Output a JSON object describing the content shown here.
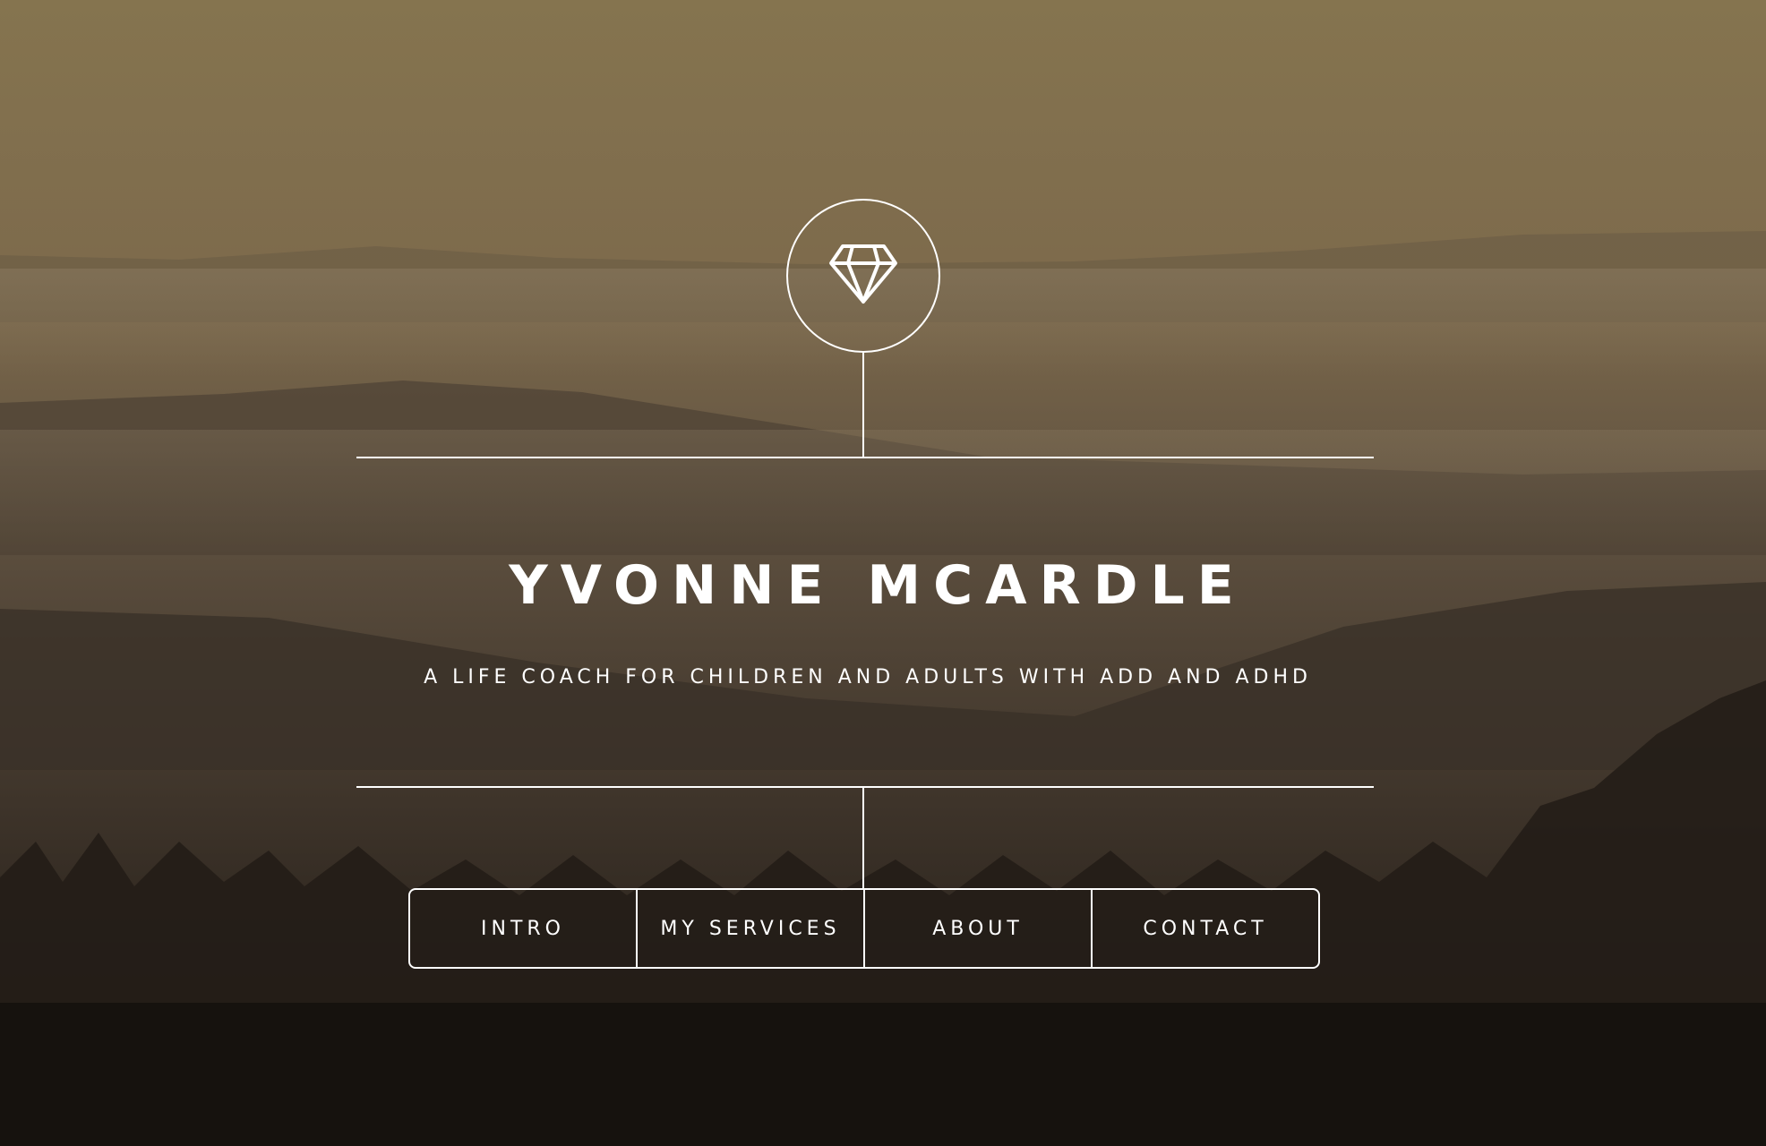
{
  "hero": {
    "logo_icon": "diamond-icon",
    "title": "YVONNE MCARDLE",
    "subtitle": "A LIFE COACH FOR CHILDREN AND ADULTS WITH ADD AND ADHD"
  },
  "nav": {
    "items": [
      {
        "label": "INTRO"
      },
      {
        "label": "MY SERVICES"
      },
      {
        "label": "ABOUT"
      },
      {
        "label": "CONTACT"
      }
    ]
  },
  "colors": {
    "line": "#ffffff",
    "text": "#ffffff",
    "sky": "#8a7656",
    "ground": "#1c1712"
  }
}
